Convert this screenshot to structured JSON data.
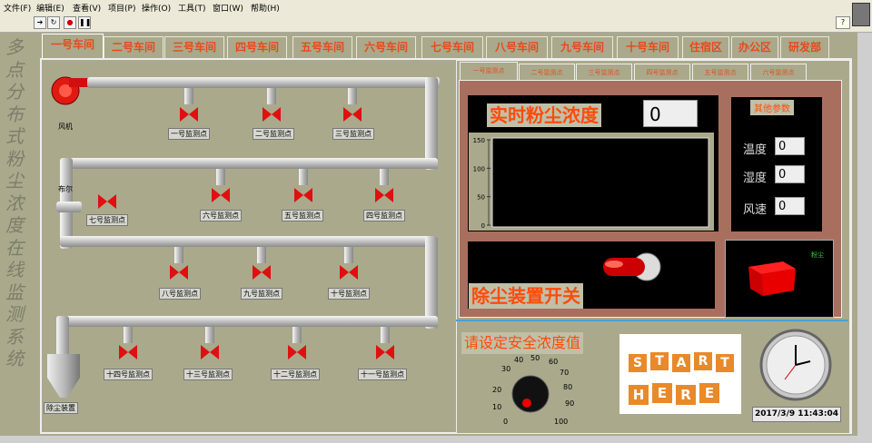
{
  "menu": [
    "文件(F)",
    "编辑(E)",
    "查看(V)",
    "项目(P)",
    "操作(O)",
    "工具(T)",
    "窗口(W)",
    "帮助(H)"
  ],
  "side_title": "多点分布式粉尘浓度在线监测系统",
  "tabs": [
    "一号车间",
    "二号车间",
    "三号车间",
    "四号车间",
    "五号车间",
    "六号车间",
    "七号车间",
    "八号车间",
    "九号车间",
    "十号车间",
    "住宿区",
    "办公区",
    "研发部"
  ],
  "fan_label": "风机",
  "elbow_label": "布尔",
  "dust_device_label": "除尘装置",
  "points": {
    "p1": "一号监测点",
    "p2": "二号监测点",
    "p3": "三号监测点",
    "p4": "四号监测点",
    "p5": "五号监测点",
    "p6": "六号监测点",
    "p7": "七号监测点",
    "p8": "八号监测点",
    "p9": "九号监测点",
    "p10": "十号监测点",
    "p11": "十一号监测点",
    "p12": "十二号监测点",
    "p13": "十三号监测点",
    "p14": "十四号监测点"
  },
  "sub_tabs": [
    "一号监测点",
    "二号监测点",
    "三号监测点",
    "四号监测点",
    "五号监测点",
    "六号监测点"
  ],
  "realtime": {
    "title": "实时粉尘浓度",
    "value": "0"
  },
  "chart_data": {
    "type": "line",
    "yticks": [
      "150",
      "100",
      "50",
      "0"
    ],
    "ylim": [
      0,
      150
    ],
    "series": []
  },
  "params": {
    "title": "其他参数",
    "temp_label": "温度",
    "temp": "0",
    "humid_label": "湿度",
    "humid": "0",
    "wind_label": "风速",
    "wind": "0"
  },
  "switch_label": "除尘装置开关",
  "mini_readout": "粉尘",
  "safe_title": "请设定安全浓度值",
  "knob_ticks": [
    "0",
    "10",
    "20",
    "30",
    "40",
    "50",
    "60",
    "70",
    "80",
    "90",
    "100"
  ],
  "start_letters": [
    "S",
    "T",
    "A",
    "R",
    "T",
    "H",
    "E",
    "R",
    "E"
  ],
  "datetime": "2017/3/9 11:43:04",
  "colors": {
    "panel": "#aaa98c",
    "accent": "#ff4a0a",
    "tab_text": "#e8491c"
  }
}
